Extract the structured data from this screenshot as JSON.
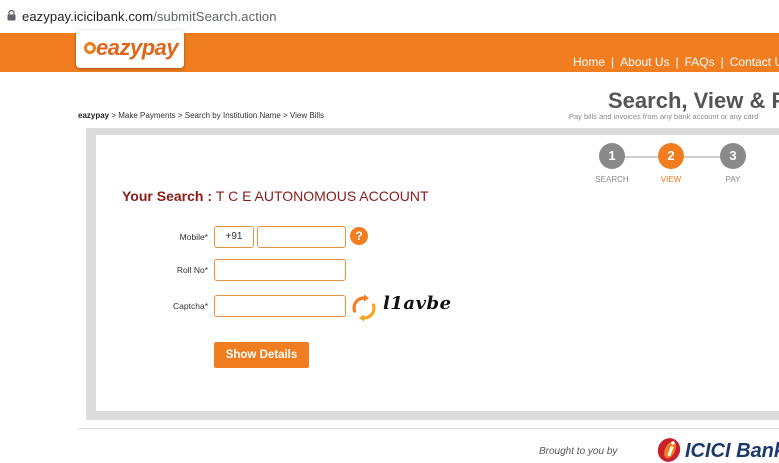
{
  "browser": {
    "url_host": "eazypay.icicibank.com",
    "url_path": "/submitSearch.action"
  },
  "header": {
    "logo_text": "eazypay",
    "nav": [
      "Home",
      "About Us",
      "FAQs",
      "Contact Us"
    ],
    "nav_sep": "|"
  },
  "breadcrumb": {
    "root": "eazypay",
    "trail": " > Make Payments > Search by Institution Name > View Bills"
  },
  "page": {
    "title": "Search, View & Pay",
    "subtitle": "Pay bills and invoices from any bank account or any card"
  },
  "steps": [
    {
      "number": "1",
      "label": "SEARCH",
      "color": "#8a8a8a"
    },
    {
      "number": "2",
      "label": "VIEW",
      "color": "#f07d1f"
    },
    {
      "number": "3",
      "label": "PAY",
      "color": "#8a8a8a"
    }
  ],
  "search": {
    "prefix": "Your Search : ",
    "value": "T C E AUTONOMOUS ACCOUNT"
  },
  "form": {
    "mobile_label": "Mobile*",
    "mobile_code": "+91",
    "mobile_value": "",
    "help": "?",
    "roll_label": "Roll No*",
    "roll_value": "",
    "captcha_label": "Captcha*",
    "captcha_value": "",
    "captcha_text": "l1avbe",
    "submit": "Show Details"
  },
  "footer": {
    "brought": "Brought to you by",
    "icici": "ICICI",
    "bank": " Bank"
  },
  "colors": {
    "accent": "#f07d1f",
    "search_label": "#8b1a1a",
    "icici_blue": "#1b3a6b"
  }
}
